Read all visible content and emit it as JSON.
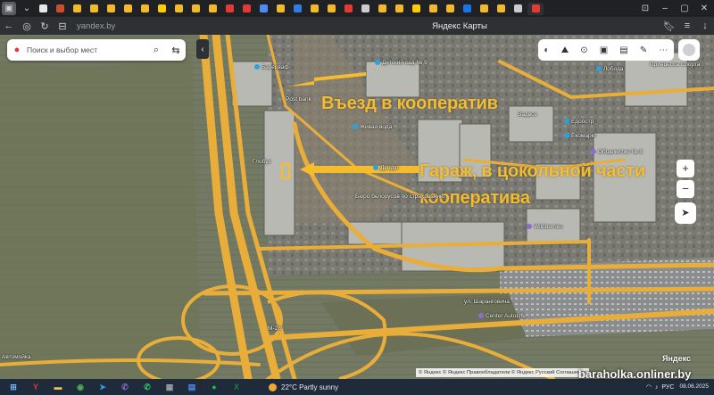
{
  "browser": {
    "url": "yandex.by",
    "page_title": "Яндекс Карты",
    "tab_colors": [
      "#e8e8e8",
      "#c94f2c",
      "#f2b92b",
      "#f2b92b",
      "#f2b92b",
      "#f2b92b",
      "#f2b92b",
      "#ffcc00",
      "#f2b92b",
      "#f2b92b",
      "#f2b92b",
      "#e53935",
      "#e53935",
      "#4c8bf5",
      "#f2b92b",
      "#2f7de1",
      "#f2b92b",
      "#f2b92b",
      "#e53935",
      "#cccccc",
      "#f2b92b",
      "#f2b92b",
      "#ffcc00",
      "#f2b92b",
      "#f2b92b",
      "#1a73e8",
      "#f2b92b",
      "#f2b92b",
      "#cccccc",
      "#e53935"
    ]
  },
  "map": {
    "search_placeholder": "Поиск и выбор мест",
    "annotations": {
      "entrance": "Въезд в кооператив",
      "garage_line1": "Гараж, в цокольной части",
      "garage_line2": "кооператива"
    },
    "poi": [
      {
        "label": "Бэрерваф"
      },
      {
        "label": "Детский сад № 9"
      },
      {
        "label": "Post bank"
      },
      {
        "label": "Живая вода"
      },
      {
        "label": "Дендю"
      },
      {
        "label": "Бюро белорусов по страхованию"
      },
      {
        "label": "Общежитие № 8"
      },
      {
        "label": "Едоостр"
      },
      {
        "label": "Вадвоз"
      },
      {
        "label": "Ёкомаркт"
      },
      {
        "label": "Wildberries"
      },
      {
        "label": "Лобода"
      },
      {
        "label": "Принцесса Спорта"
      },
      {
        "label": "Глобус"
      },
      {
        "label": "ул. Шаранговича"
      },
      {
        "label": "Center AutoLife"
      },
      {
        "label": "М-28"
      },
      {
        "label": "Автомойка"
      }
    ],
    "attribution": "© Яндекс  © Яндекс  Правообладатели   © Яндекс  Русский  Соглашение",
    "logo": "Яндекс"
  },
  "taskbar": {
    "weather": "22°C  Partly sunny",
    "lang": "РУС",
    "date": "08.06.2025",
    "apps": [
      "windows",
      "yandex",
      "files",
      "chrome",
      "telegram",
      "viber",
      "whatsapp",
      "calculator",
      "calendar",
      "spotify",
      "excel"
    ]
  },
  "watermark": "baraholka.onliner.by"
}
